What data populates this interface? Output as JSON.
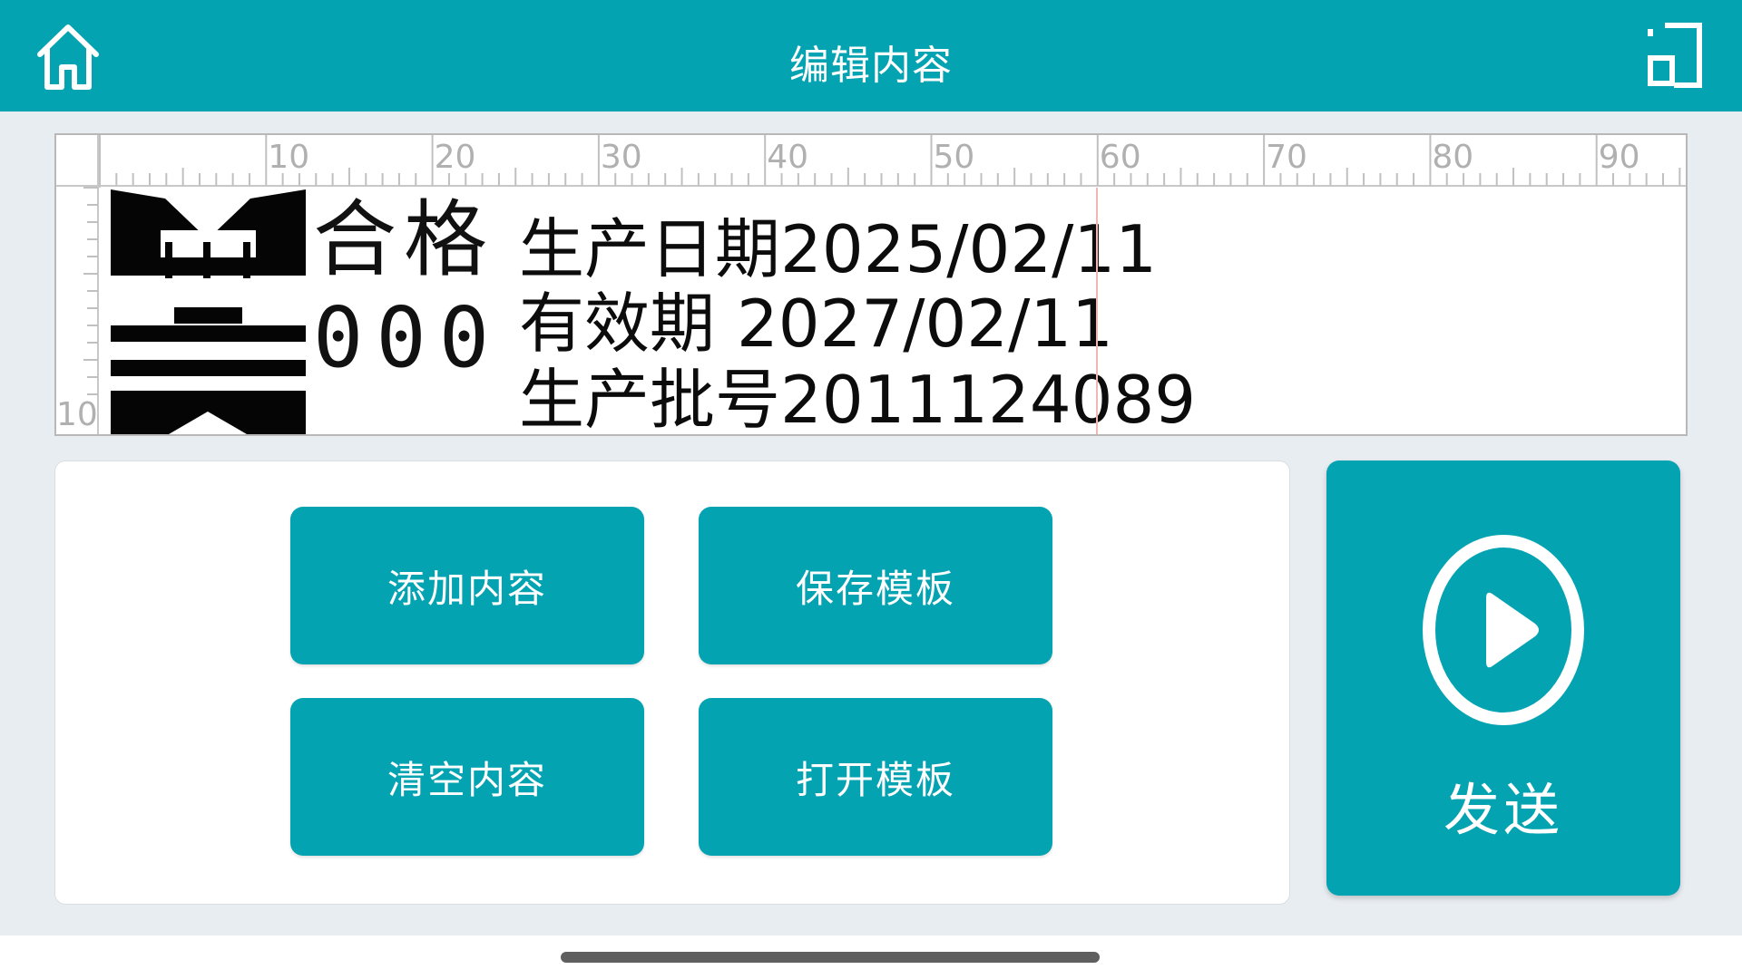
{
  "header": {
    "title": "编辑内容",
    "home_icon": "home-icon",
    "window_icon": "window-icon"
  },
  "ruler": {
    "top_labels": [
      "10",
      "20",
      "30",
      "40",
      "50",
      "60",
      "70",
      "80",
      "90"
    ],
    "left_labels": [
      "10"
    ]
  },
  "preview": {
    "dot_text_line1": "合格",
    "dot_text_line2": "000",
    "lines": [
      {
        "label": "生产日期",
        "value": "2025/02/11"
      },
      {
        "label": "有效期",
        "value": "2027/02/11"
      },
      {
        "label": "生产批号",
        "value": "2011124089"
      }
    ]
  },
  "buttons": {
    "add_content": "添加内容",
    "save_template": "保存模板",
    "clear_content": "清空内容",
    "open_template": "打开模板"
  },
  "send": {
    "label": "发送",
    "icon": "play-circle-icon"
  },
  "colors": {
    "primary": "#04a3b2",
    "background": "#e8edf1"
  }
}
